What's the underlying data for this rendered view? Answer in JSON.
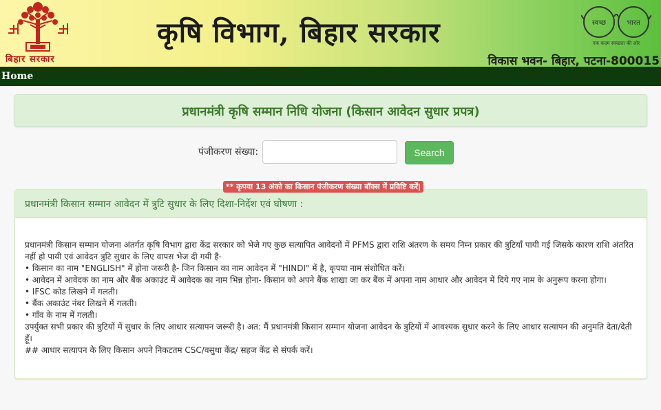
{
  "header": {
    "logo_caption": "बिहार सरकार",
    "title": "कृषि विभाग, बिहार सरकार",
    "swachh_text_left": "स्वच्छ",
    "swachh_text_right": "भारत",
    "swachh_tagline": "एक कदम स्वच्छता की ओर",
    "address": "विकास भवन- बिहार, पटना-800015"
  },
  "nav": {
    "home": "Home"
  },
  "banner": {
    "title": "प्रधानमंत्री कृषि सम्मान निधि योजना (किसान आवेदन सुधार प्रपत्र)"
  },
  "search": {
    "label": "पंजीकरण संख्या:",
    "value": "",
    "placeholder": "",
    "button": "Search",
    "warning": "** कृपया 13 अंको का किसान पंजीकरण संख्या बॉक्स में प्रविष्टि करें|"
  },
  "notice": {
    "heading": "प्रधानमंत्री किसान सम्मान आवेदन में त्रुटि सुधार के लिए दिशा-निर्देश एवं घोषणा :",
    "lines": [
      "प्रधानमंत्री किसान सम्मान योजना अंतर्गत कृषि विभाग द्वारा केंद्र सरकार को भेजे गए कुछ सत्यापित आवेदनों में PFMS द्वारा राशि अंतरण के समय निम्न प्रकार की त्रुटियाँ पायी गई जिसके कारण राशि अंतरित नहीं हो पायी एवं आवेदन त्रुटि सुधार के लिए वापस भेज दी गयी है-",
      "• किसान का नाम \"ENGLISH\" में होना जरूरी है- जिन किसान का नाम आवेदन में \"HINDI\" में है, कृपया नाम संशोधित करें।",
      "• आवेदन में आवेदक का नाम और बैंक अकाउंट में आवेदक का नाम भिन्न होना- किसान को अपने बैंक शाखा जा कर बैंक में अपना नाम आधार और आवेदन में दिये गए नाम के अनुरूप करना होगा।",
      "• IFSC कोड लिखने में गलती।",
      "• बैंक अकाउंट नंबर लिखने में गलती।",
      "• गाँव के नाम में गलती।",
      "उपर्युक्त सभी प्रकार की त्रुटियों में सुधार के लिए आधार सत्यापन जरूरी है। अत: मैं प्रधानमंत्री किसान सम्मान योजना आवेदन के त्रुटियों में आवश्यक सुधार करने के लिए आधार सत्यापन की अनुमति देता/देती हूँ।",
      "## आधार सत्यापन के लिए किसान अपने निकटतम CSC/वसुधा केंद्र/ सहज केंद्र से संपर्क करें।"
    ]
  },
  "colors": {
    "nav_bg": "#0e3a0e",
    "banner_bg": "#dff0d8",
    "banner_text": "#3a7a28",
    "search_button": "#5cb85c",
    "warning_bg": "#d9534f"
  }
}
